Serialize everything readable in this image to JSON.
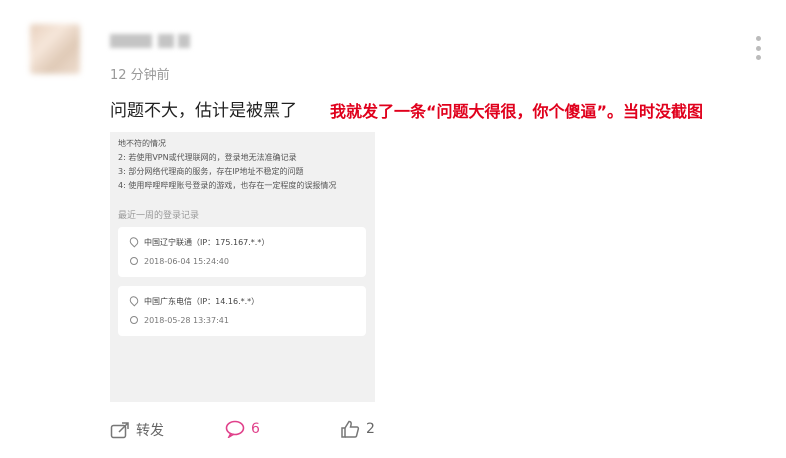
{
  "comment": {
    "author": "",
    "timestamp": "12 分钟前",
    "text": "问题不大，估计是被黑了",
    "annotation": "我就发了一条“问题大得很，你个傻逼”。当时没截图"
  },
  "screenshot": {
    "lines": [
      "地不符的情况",
      "2: 若使用VPN或代理联网的，登录地无法准确记录",
      "3: 部分网络代理商的服务，存在IP地址不稳定的问题",
      "4: 使用哔哩哔哩账号登录的游戏，也存在一定程度的误报情况"
    ],
    "section_title": "最近一周的登录记录",
    "records": [
      {
        "location": "中国辽宁联通（IP：175.167.*.*）",
        "time": "2018-06-04 15:24:40"
      },
      {
        "location": "中国广东电信（IP：14.16.*.*）",
        "time": "2018-05-28 13:37:41"
      }
    ]
  },
  "actions": {
    "share_label": "转发",
    "comment_count": "6",
    "like_count": "2"
  },
  "colors": {
    "annotation": "#e0001c",
    "comment_accent": "#e0408a",
    "muted": "#999999"
  },
  "icons": [
    "more-icon",
    "share-icon",
    "comment-icon",
    "like-icon",
    "location-pin-icon",
    "clock-icon"
  ]
}
